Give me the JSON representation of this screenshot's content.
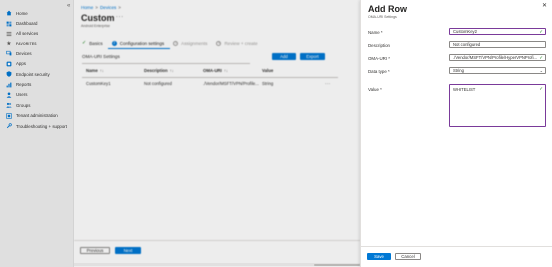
{
  "sidebar": {
    "items": [
      {
        "label": "Home",
        "icon": "home-icon",
        "color": "#0078d4"
      },
      {
        "label": "Dashboard",
        "icon": "dashboard-icon",
        "color": "#0078d4"
      },
      {
        "label": "All services",
        "icon": "list-icon",
        "color": "#605e5c"
      },
      {
        "label": "FAVORITES",
        "icon": "star-icon",
        "color": "#605e5c"
      },
      {
        "label": "Devices",
        "icon": "devices-icon",
        "color": "#0078d4"
      },
      {
        "label": "Apps",
        "icon": "apps-icon",
        "color": "#0078d4"
      },
      {
        "label": "Endpoint security",
        "icon": "shield-icon",
        "color": "#0078d4"
      },
      {
        "label": "Reports",
        "icon": "reports-icon",
        "color": "#0078d4"
      },
      {
        "label": "Users",
        "icon": "user-icon",
        "color": "#0078d4"
      },
      {
        "label": "Groups",
        "icon": "groups-icon",
        "color": "#0078d4"
      },
      {
        "label": "Tenant administration",
        "icon": "tenant-admin-icon",
        "color": "#0078d4"
      },
      {
        "label": "Troubleshooting + support",
        "icon": "wrench-icon",
        "color": "#0078d4"
      }
    ]
  },
  "main": {
    "breadcrumb": {
      "home": "Home",
      "sep": ">",
      "devices": "Devices",
      "sep2": ">"
    },
    "title": "Custom",
    "more": "...",
    "subtitle": "Android Enterprise",
    "steps": [
      {
        "label": "Basics",
        "state": "done",
        "marker": "✓"
      },
      {
        "label": "Configuration settings",
        "state": "current",
        "marker": "2"
      },
      {
        "label": "Assignments",
        "state": "future",
        "marker": "3"
      },
      {
        "label": "Review + create",
        "state": "future",
        "marker": "4"
      }
    ],
    "section_title": "OMA-URI Settings",
    "add_label": "Add",
    "export_label": "Export",
    "table": {
      "columns": [
        {
          "label": "Name",
          "sort": "↑↓"
        },
        {
          "label": "Description",
          "sort": "↑↓"
        },
        {
          "label": "OMA-URI",
          "sort": "↑↓"
        },
        {
          "label": "Value",
          "sort": ""
        }
      ],
      "rows": [
        {
          "name": "CustomKey1",
          "description": "Not configured",
          "oma_uri": "./Vendor/MSFT/VPN/Profile...",
          "value": "String",
          "more": "..."
        }
      ]
    },
    "previous_label": "Previous",
    "next_label": "Next"
  },
  "panel": {
    "title": "Add Row",
    "subtitle": "OMA-URI Settings",
    "close": "✕",
    "fields": {
      "name_label": "Name *",
      "name_value": "CustomKey2",
      "description_label": "Description",
      "description_value": "Not configured",
      "oma_uri_label": "OMA-URI *",
      "oma_uri_value": "./Vendor/MSFT/VPN/Profile/HyperVPNProfi...",
      "data_type_label": "Data type *",
      "data_type_value": "String",
      "value_label": "Value *",
      "value_value": "WHITELIST"
    },
    "save_label": "Save",
    "cancel_label": "Cancel"
  },
  "colors": {
    "accent": "#0078d4",
    "focus_border": "#7a3a9a",
    "valid_check": "#107c10"
  }
}
